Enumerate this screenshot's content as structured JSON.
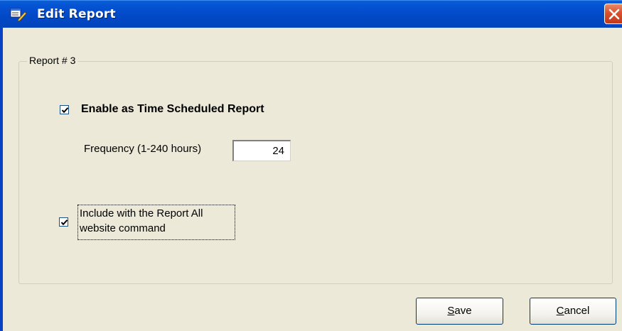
{
  "window": {
    "title": "Edit Report",
    "icons": {
      "app": "edit-report-icon",
      "close": "close-icon"
    }
  },
  "group": {
    "legend": "Report # 3"
  },
  "schedule": {
    "enable_label": "Enable as Time Scheduled Report",
    "enabled": true,
    "frequency_label": "Frequency (1-240 hours)",
    "frequency_value": "24"
  },
  "include": {
    "checked": true,
    "line1": "Include with the Report All",
    "line2": "website command"
  },
  "buttons": {
    "save_mnemonic": "S",
    "save_rest": "ave",
    "cancel_mnemonic": "C",
    "cancel_rest": "ancel"
  },
  "colors": {
    "titlebar": "#0248c6",
    "dialog_bg": "#ece9d8",
    "close_button": "#d9512c",
    "button_border": "#003c74"
  }
}
